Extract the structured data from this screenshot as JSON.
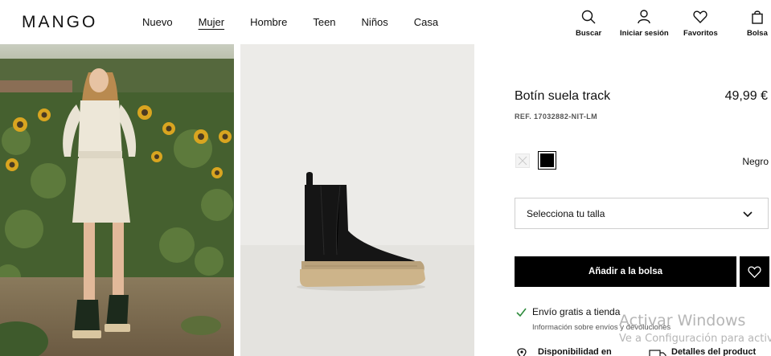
{
  "header": {
    "logo": "MANGO",
    "nav": [
      "Nuevo",
      "Mujer",
      "Hombre",
      "Teen",
      "Niños",
      "Casa"
    ],
    "active_nav": "Mujer",
    "actions": {
      "search": "Buscar",
      "login": "Iniciar sesión",
      "favorites": "Favoritos",
      "bag": "Bolsa"
    }
  },
  "product": {
    "title": "Botín suela track",
    "price": "49,99 €",
    "ref": "REF. 17032882-NIT-LM",
    "color_name": "Negro",
    "size_select": "Selecciona tu talla",
    "add_button": "Añadir a la bolsa",
    "shipping_title": "Envío gratis a tienda",
    "shipping_sub": "Información sobre envíos y devoluciones",
    "availability": "Disponibilidad en",
    "details": "Detalles del product"
  },
  "watermark": {
    "line1": "Activar Windows",
    "line2": "Ve a Configuración para activ"
  },
  "colors": {
    "accent_check": "#2e8b3c",
    "button_bg": "#000000"
  }
}
